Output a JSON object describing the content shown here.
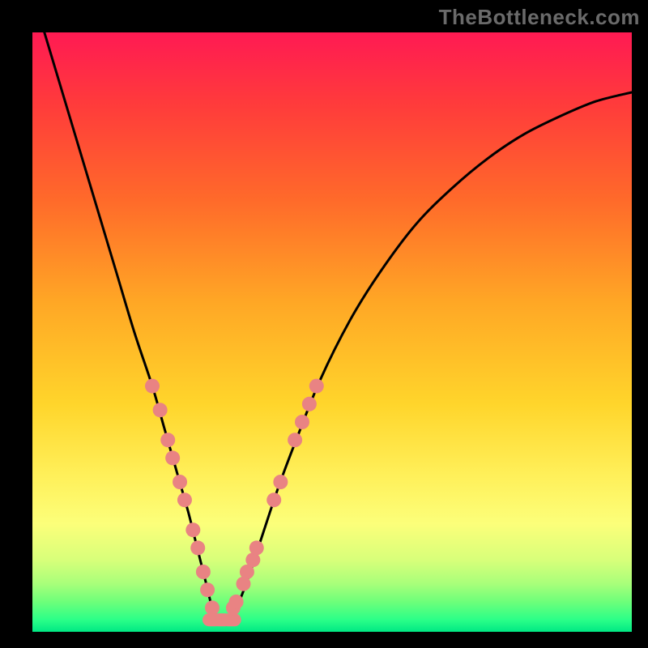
{
  "watermark": "TheBottleneck.com",
  "chart_data": {
    "type": "line",
    "title": "",
    "xlabel": "",
    "ylabel": "",
    "xlim": [
      0,
      100
    ],
    "ylim": [
      0,
      100
    ],
    "grid": false,
    "series": [
      {
        "name": "bottleneck-curve",
        "color": "#000000",
        "x": [
          2,
          5,
          8,
          11,
          14,
          17,
          20,
          22,
          24,
          26,
          27,
          28,
          29,
          30,
          31,
          32,
          34,
          36,
          38,
          41,
          44,
          48,
          53,
          58,
          64,
          70,
          76,
          82,
          88,
          94,
          100
        ],
        "y": [
          100,
          90,
          80,
          70,
          60,
          50,
          41,
          34,
          27,
          20,
          16,
          12,
          8,
          4,
          2,
          2,
          4,
          9,
          15,
          24,
          32,
          42,
          52,
          60,
          68,
          74,
          79,
          83,
          86,
          88.5,
          90
        ]
      }
    ],
    "markers": [
      {
        "name": "data-points-left",
        "shape": "circle",
        "color": "#e98383",
        "radius_px": 9,
        "points": [
          {
            "x": 20.0,
            "y": 41
          },
          {
            "x": 21.3,
            "y": 37
          },
          {
            "x": 22.6,
            "y": 32
          },
          {
            "x": 23.4,
            "y": 29
          },
          {
            "x": 24.6,
            "y": 25
          },
          {
            "x": 25.4,
            "y": 22
          },
          {
            "x": 26.8,
            "y": 17
          },
          {
            "x": 27.6,
            "y": 14
          },
          {
            "x": 28.5,
            "y": 10
          },
          {
            "x": 29.2,
            "y": 7
          },
          {
            "x": 30.0,
            "y": 4
          }
        ]
      },
      {
        "name": "data-points-bottom",
        "shape": "rounded-rect",
        "color": "#e98383",
        "points": [
          {
            "x": 30.0,
            "y": 2
          },
          {
            "x": 31.6,
            "y": 2
          },
          {
            "x": 33.2,
            "y": 2
          }
        ]
      },
      {
        "name": "data-points-right",
        "shape": "circle",
        "color": "#e98383",
        "radius_px": 9,
        "points": [
          {
            "x": 33.5,
            "y": 4
          },
          {
            "x": 34.0,
            "y": 5
          },
          {
            "x": 35.2,
            "y": 8
          },
          {
            "x": 35.8,
            "y": 10
          },
          {
            "x": 36.8,
            "y": 12
          },
          {
            "x": 37.4,
            "y": 14
          },
          {
            "x": 40.3,
            "y": 22
          },
          {
            "x": 41.4,
            "y": 25
          },
          {
            "x": 43.8,
            "y": 32
          },
          {
            "x": 45.0,
            "y": 35
          },
          {
            "x": 46.2,
            "y": 38
          },
          {
            "x": 47.4,
            "y": 41
          }
        ]
      }
    ]
  }
}
